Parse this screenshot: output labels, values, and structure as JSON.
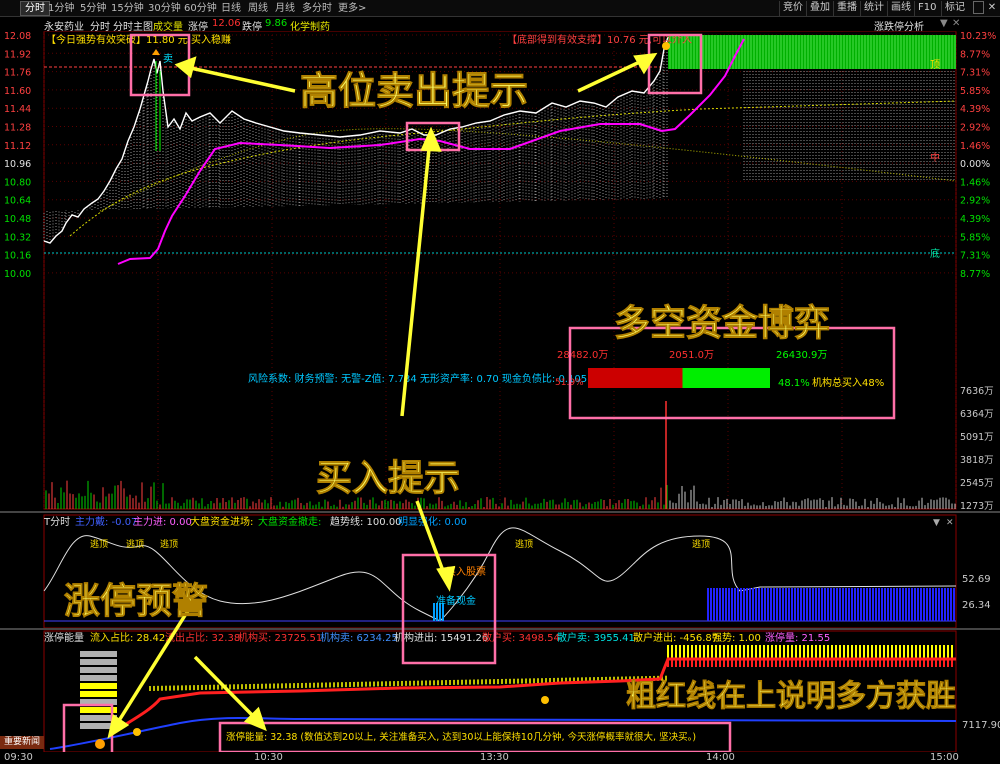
{
  "tabs": [
    "分时",
    "1分钟",
    "5分钟",
    "15分钟",
    "30分钟",
    "60分钟",
    "日线",
    "周线",
    "月线",
    "多分时",
    "更多>"
  ],
  "right_buttons": [
    "竞价",
    "叠加",
    "重播",
    "统计",
    "画线",
    "F10",
    "标记"
  ],
  "info": {
    "stock_name": "永安药业",
    "chart_mode": "分时",
    "main_chart": "分时主图",
    "volume": "成交量",
    "limit_up_label": "涨停",
    "limit_up": "12.06",
    "limit_down_label": "跌停",
    "limit_down": "9.86",
    "sector": "化学制药",
    "analysis": "涨跌停分析"
  },
  "price_axis": [
    "12.08",
    "11.92",
    "11.76",
    "11.60",
    "11.44",
    "11.28",
    "11.12",
    "10.96",
    "10.80",
    "10.64",
    "10.48",
    "10.32",
    "10.16",
    "10.00"
  ],
  "pct_axis": [
    "10.23%",
    "8.77%",
    "7.31%",
    "5.85%",
    "4.39%",
    "2.92%",
    "1.46%",
    "0.00%",
    "1.46%",
    "2.92%",
    "4.39%",
    "5.85%",
    "7.31%",
    "8.77%"
  ],
  "vol_axis": [
    "7636万",
    "6364万",
    "5091万",
    "3818万",
    "2545万",
    "1273万"
  ],
  "signals": {
    "strong_break": "【今日强势有效突破】11.80 元,买入稳赚",
    "bottom_support": "【底部得到有效支撑】10.76 元,可以介入",
    "sell_mark": "卖",
    "zhong": "中",
    "di": "底",
    "ding": "顶"
  },
  "risk_line": "风险系数: 财务预警: 无警-Z值: 7.734 无形资产率: 0.70 现金负债比: 0.105",
  "capital": {
    "sell_amount": "28482.0万",
    "mid_amount": "2051.0万",
    "buy_amount": "26430.9万",
    "sell_pct": "51.9%",
    "buy_pct": "48.1%",
    "inst_label": "机构总买入48%"
  },
  "sub1": {
    "title": "T分时",
    "items": [
      "主力戴: -0.07",
      "主力进: 0.00",
      "大盘资金进场:",
      "大盘资金撤走:",
      "趋势线: 100.00",
      "明显强化: 0.00"
    ],
    "axis": [
      "52.69",
      "26.34"
    ],
    "tags": {
      "escape": "逃顶",
      "buy_stock": "买入股票",
      "prepare": "准备现金"
    }
  },
  "sub2": {
    "title": "涨停能量",
    "items": [
      "流入占比: 28.42",
      "流出占比: 32.38",
      "机构买: 23725.51",
      "机构卖: 6234.25",
      "机构进出: 15491.26",
      "散户买: 3498.54",
      "散户卖: 3955.41",
      "散户进出: -456.87",
      "强势: 1.00",
      "涨停量: 21.55"
    ],
    "axis": [
      "7117.90"
    ],
    "note": "涨停能量: 32.38 (数值达到20以上, 关注准备买入, 达到30以上能保持10几分钟, 今天涨停概率就很大, 坚决买。)"
  },
  "time_axis": [
    "09:30",
    "10:30",
    "13:30",
    "14:00",
    "15:00"
  ],
  "news_button": "重要新闻",
  "annotations": {
    "high_sell": "高位卖出提示",
    "capital_game": "多空资金博弈",
    "buy_hint": "买入提示",
    "limit_warning": "涨停预警",
    "red_line": "粗红线在上说明多方获胜"
  },
  "colors": {
    "price_line": "#ffffff",
    "avg_line": "#ff00ff",
    "limit_green": "#00ff00",
    "sell_bar": "#ff1010",
    "buy_bar": "#00ff00",
    "annotation_text": "#ffff66",
    "annotation_box": "#ff6fa8",
    "arrow": "#ffff33",
    "volume_blue": "#2323ff"
  },
  "chart_data": {
    "type": "line",
    "x": [
      "09:30",
      "10:30",
      "13:30",
      "14:00",
      "15:00"
    ],
    "series": [],
    "ylim": [
      10.0,
      12.08
    ],
    "grid": true
  }
}
